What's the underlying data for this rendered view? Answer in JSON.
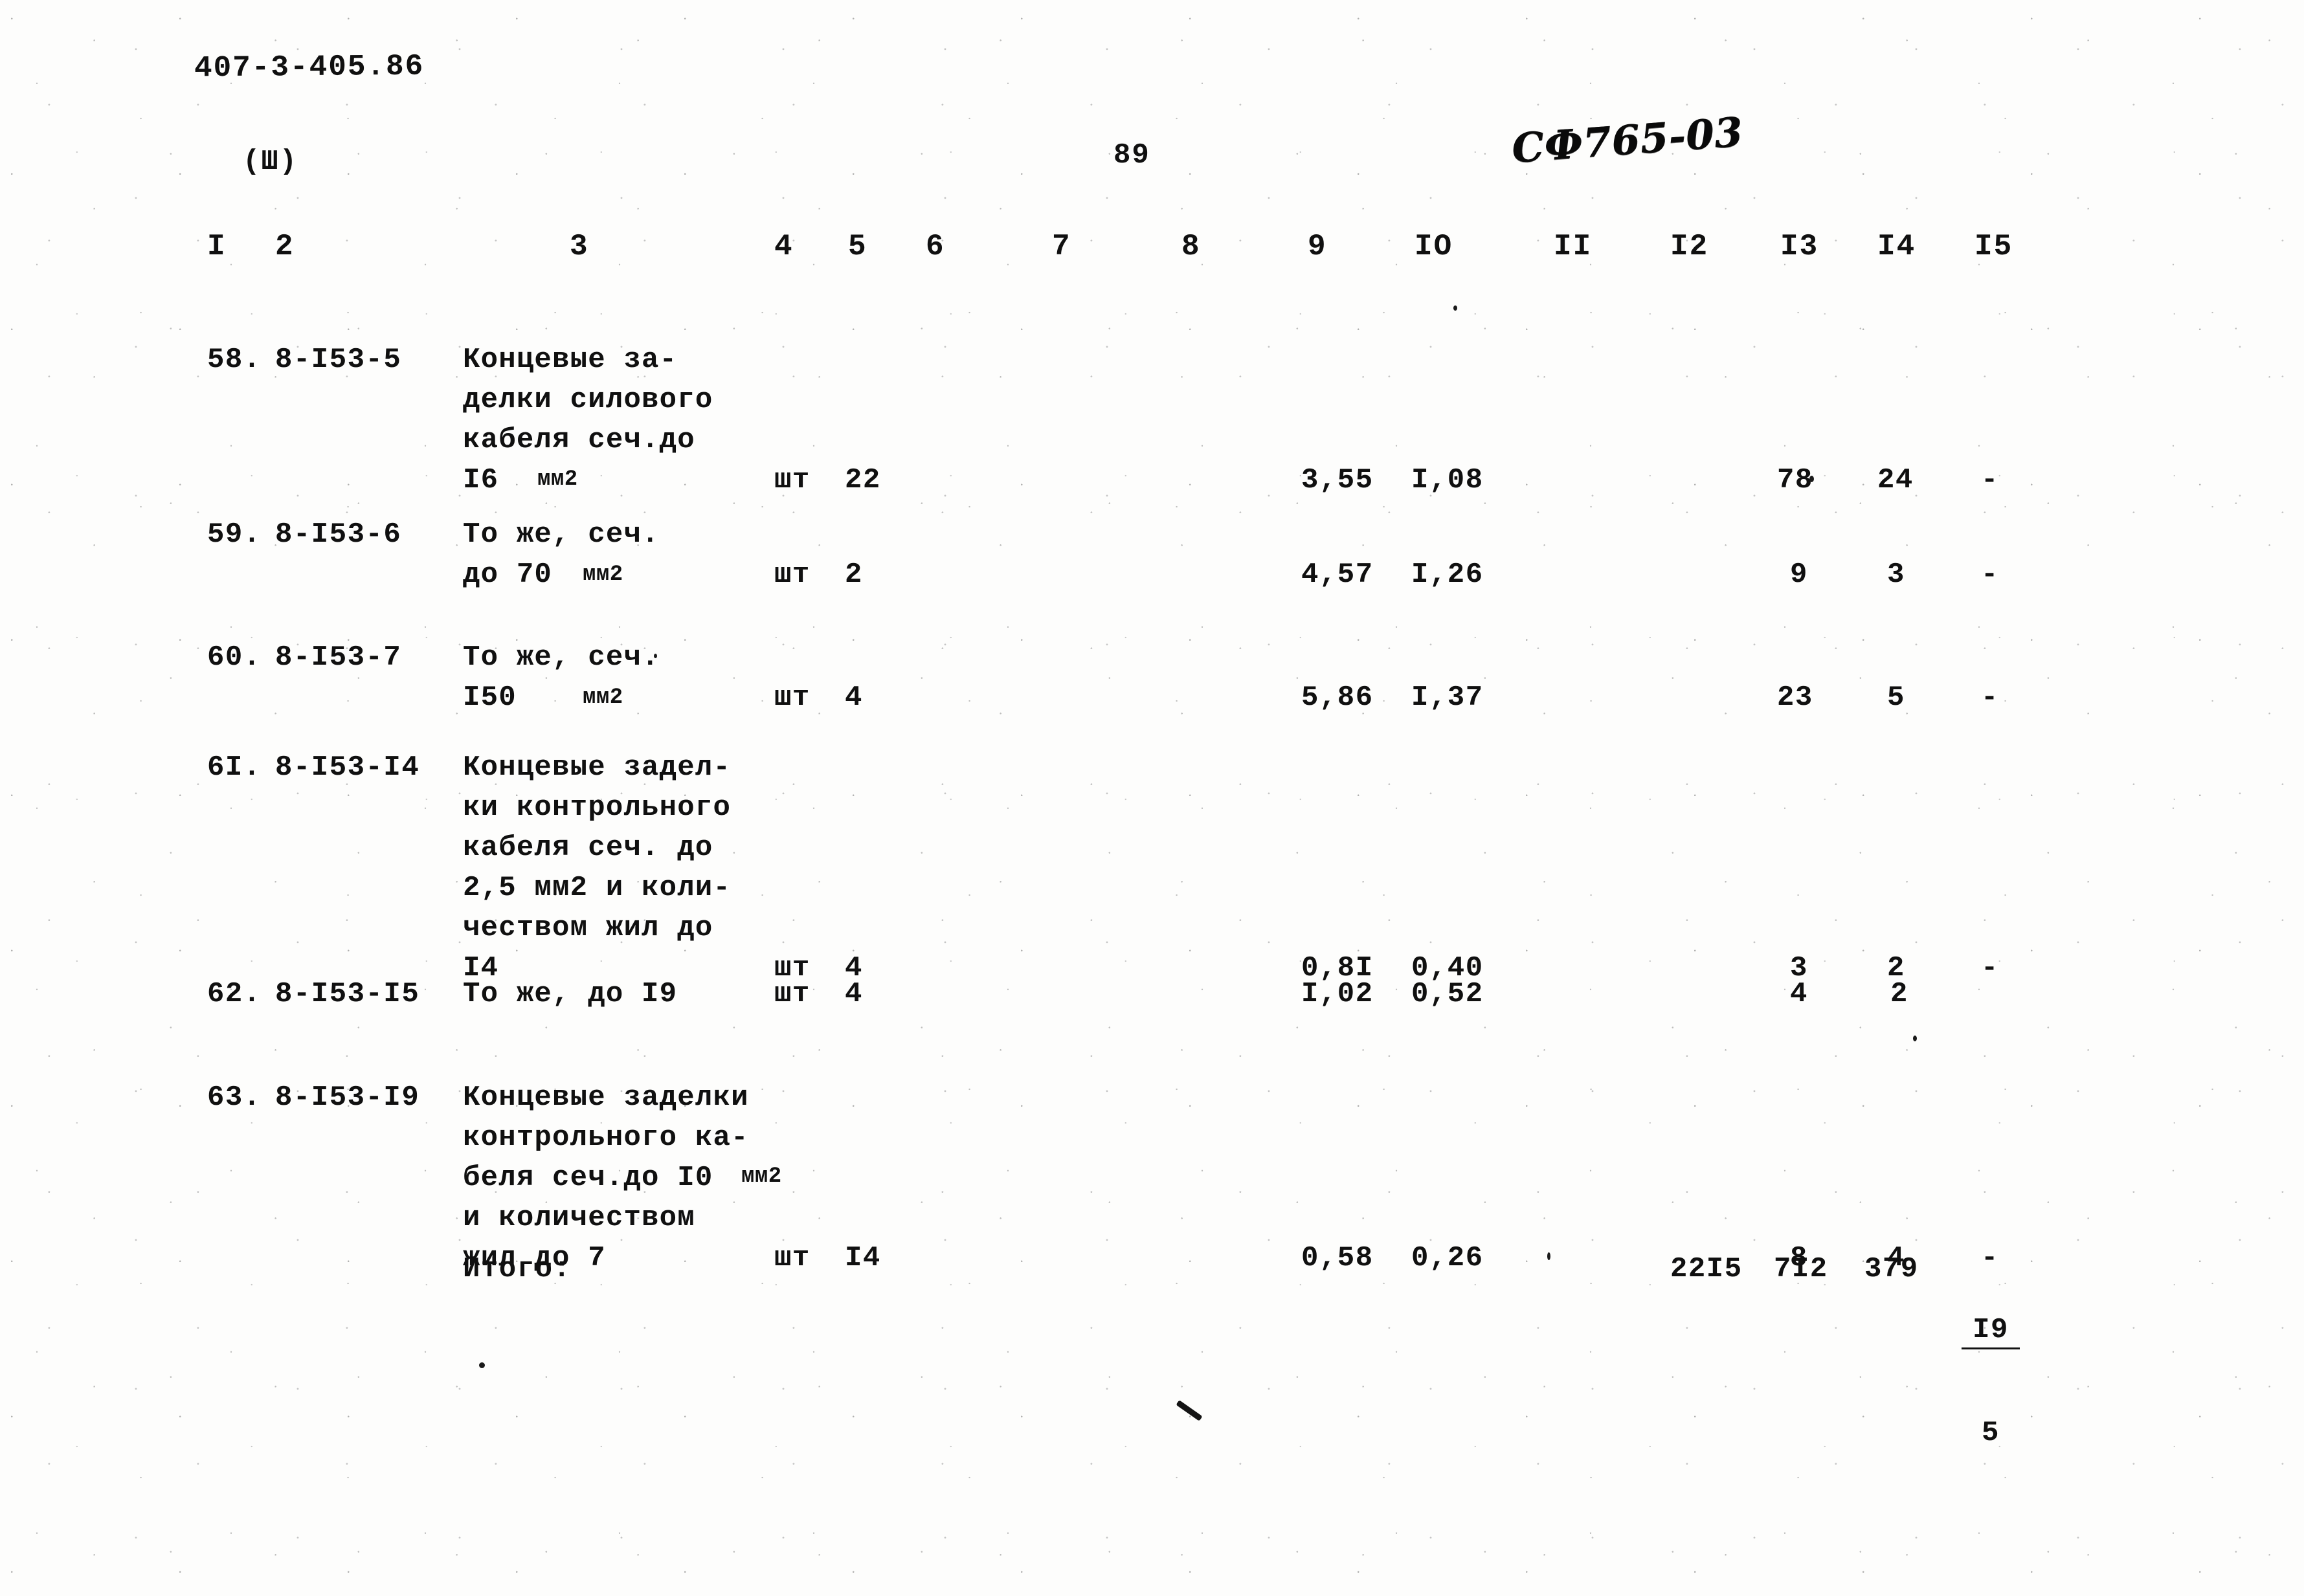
{
  "document": {
    "doc_code": "407-3-405.86",
    "sheet_marker": "(Ш)",
    "page_number": "89",
    "hand_code": "СФ765-03"
  },
  "table": {
    "column_headers": [
      "I",
      "2",
      "3",
      "4",
      "5",
      "6",
      "7",
      "8",
      "9",
      "IO",
      "II",
      "I2",
      "I3",
      "I4",
      "I5"
    ],
    "rows": [
      {
        "num": "58.",
        "code": "8-I53-5",
        "desc": "Концевые за-\nделки силового\nкабеля сеч.до\nI6",
        "desc_unit": "мм2",
        "unit": "шт",
        "qty": "22",
        "c9": "3,55",
        "c10": "I,08",
        "c13": "78",
        "c14": "24",
        "c15": "-"
      },
      {
        "num": "59.",
        "code": "8-I53-6",
        "desc": "То же, сеч.\nдо 70",
        "desc_unit": "мм2",
        "unit": "шт",
        "qty": "2",
        "c9": "4,57",
        "c10": "I,26",
        "c13": "9",
        "c14": "3",
        "c15": "-"
      },
      {
        "num": "60.",
        "code": "8-I53-7",
        "desc": "То же, сеч.\nI50",
        "desc_unit": "мм2",
        "unit": "шт",
        "qty": "4",
        "c9": "5,86",
        "c10": "I,37",
        "c13": "23",
        "c14": "5",
        "c15": "-"
      },
      {
        "num": "6I.",
        "code": "8-I53-I4",
        "desc": "Концевые задел-\nки контрольного\nкабеля сеч. до\n2,5 мм2 и коли-\nчеством жил до\nI4",
        "desc_unit": "",
        "unit": "шт",
        "qty": "4",
        "c9": "0,8I",
        "c10": "0,40",
        "c13": "3",
        "c14": "2",
        "c15": "-"
      },
      {
        "num": "62.",
        "code": "8-I53-I5",
        "desc": "То же, до I9",
        "desc_unit": "",
        "unit": "шт",
        "qty": "4",
        "c9": "I,02",
        "c10": "0,52",
        "c13": "4",
        "c14": "2",
        "c15": ""
      },
      {
        "num": "63.",
        "code": "8-I53-I9",
        "desc": "Концевые заделки\nконтрольного ка-\nбеля сеч.до I0",
        "desc_unit": "мм2",
        "desc_tail": "и количеством\nжил до 7",
        "unit": "шт",
        "qty": "I4",
        "c9": "0,58",
        "c10": "0,26",
        "c13": "8",
        "c14": "4",
        "c15": "-"
      }
    ],
    "total": {
      "label": "Итого:",
      "c12": "22I5",
      "c13": "7I2",
      "c14": "379",
      "c15_top": "I9",
      "c15_bottom": "5"
    }
  }
}
